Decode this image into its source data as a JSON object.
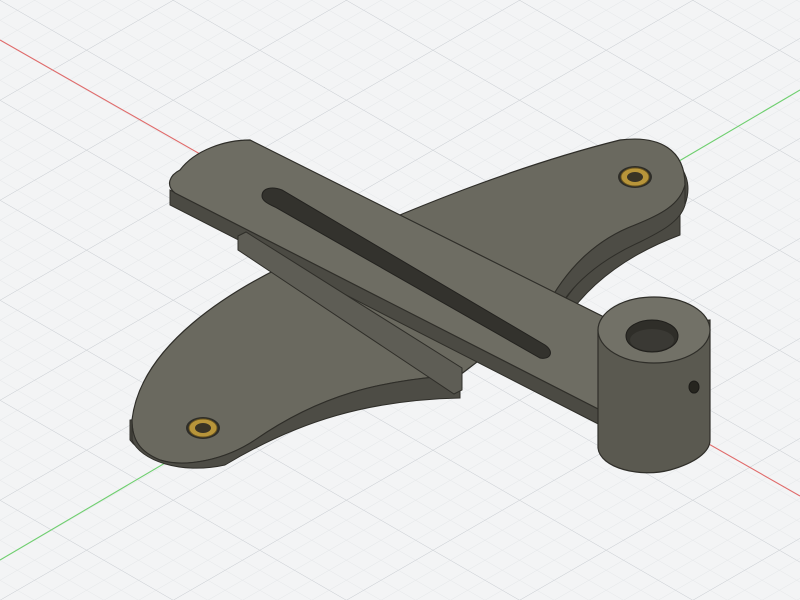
{
  "viewport": {
    "background": "#f3f4f5",
    "grid_minor_color": "#dfe2e5",
    "grid_major_color": "#c9cdd2",
    "axis_x_color": "#e06a6a",
    "axis_y_color": "#6fcf6f"
  },
  "model": {
    "body_color": "#5b5a52",
    "top_face_color": "#6a695f",
    "side_face_color": "#4b4a43",
    "edge_color": "#2f2e29",
    "insert_color": "#b8953a"
  }
}
